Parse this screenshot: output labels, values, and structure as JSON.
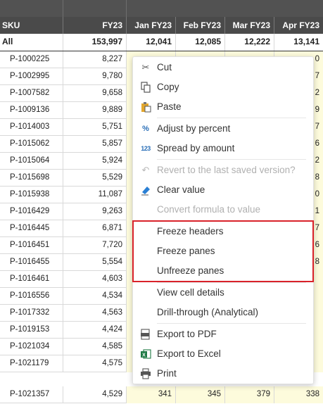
{
  "columns": {
    "sku": "SKU",
    "fy": "FY23",
    "months": [
      "Jan FY23",
      "Feb FY23",
      "Mar FY23",
      "Apr FY23"
    ]
  },
  "all_row": {
    "label": "All",
    "fy": "153,997",
    "months": [
      "12,041",
      "12,085",
      "12,222",
      "13,141"
    ]
  },
  "rows": [
    {
      "sku": "P-1000225",
      "fy": "8,227",
      "apr_tail": "0"
    },
    {
      "sku": "P-1002995",
      "fy": "9,780",
      "apr_tail": "7"
    },
    {
      "sku": "P-1007582",
      "fy": "9,658",
      "apr_tail": "2"
    },
    {
      "sku": "P-1009136",
      "fy": "9,889",
      "apr_tail": "9"
    },
    {
      "sku": "P-1014003",
      "fy": "5,751",
      "apr_tail": "7"
    },
    {
      "sku": "P-1015062",
      "fy": "5,857",
      "apr_tail": "6"
    },
    {
      "sku": "P-1015064",
      "fy": "5,924",
      "apr_tail": "2"
    },
    {
      "sku": "P-1015698",
      "fy": "5,529",
      "apr_tail": "8"
    },
    {
      "sku": "P-1015938",
      "fy": "11,087",
      "apr_tail": "0"
    },
    {
      "sku": "P-1016429",
      "fy": "9,263",
      "apr_tail": "1"
    },
    {
      "sku": "P-1016445",
      "fy": "6,871",
      "apr_tail": "7"
    },
    {
      "sku": "P-1016451",
      "fy": "7,720",
      "apr_tail": "6"
    },
    {
      "sku": "P-1016455",
      "fy": "5,554",
      "apr_tail": "8"
    },
    {
      "sku": "P-1016461",
      "fy": "4,603",
      "apr_tail": ""
    },
    {
      "sku": "P-1016556",
      "fy": "4,534",
      "apr_tail": ""
    },
    {
      "sku": "P-1017332",
      "fy": "4,563",
      "apr_tail": ""
    },
    {
      "sku": "P-1019153",
      "fy": "4,424",
      "apr_tail": ""
    },
    {
      "sku": "P-1021034",
      "fy": "4,585",
      "apr_tail": ""
    },
    {
      "sku": "P-1021179",
      "fy": "4,575",
      "apr_tail": ""
    }
  ],
  "last_row": {
    "sku": "P-1021357",
    "fy": "4,529",
    "months": [
      "341",
      "345",
      "379",
      "338"
    ]
  },
  "menu": {
    "items": [
      {
        "label": "Cut",
        "icon": "scissors-icon",
        "disabled": false
      },
      {
        "label": "Copy",
        "icon": "copy-icon",
        "disabled": false
      },
      {
        "label": "Paste",
        "icon": "paste-icon",
        "disabled": false
      },
      {
        "label": "Adjust by percent",
        "icon": "percent-icon",
        "disabled": false
      },
      {
        "label": "Spread by amount",
        "icon": "spread-123-icon",
        "disabled": false
      },
      {
        "label": "Revert to the last saved version?",
        "icon": "undo-icon",
        "disabled": true
      },
      {
        "label": "Clear value",
        "icon": "eraser-icon",
        "disabled": false
      },
      {
        "label": "Convert formula to value",
        "icon": "",
        "disabled": true
      },
      {
        "label": "Freeze headers",
        "icon": "",
        "disabled": false
      },
      {
        "label": "Freeze panes",
        "icon": "",
        "disabled": false
      },
      {
        "label": "Unfreeze panes",
        "icon": "",
        "disabled": false
      },
      {
        "label": "View cell details",
        "icon": "",
        "disabled": false
      },
      {
        "label": "Drill-through (Analytical)",
        "icon": "",
        "disabled": false
      },
      {
        "label": "Export to PDF",
        "icon": "pdf-icon",
        "disabled": false
      },
      {
        "label": "Export to Excel",
        "icon": "excel-icon",
        "disabled": false
      },
      {
        "label": "Print",
        "icon": "printer-icon",
        "disabled": false
      }
    ]
  },
  "colors": {
    "header_bg": "#4a4a4a",
    "edited_cell_bg": "#fdfbdc",
    "highlight_border": "#d9222a",
    "excel_green": "#1e7a45",
    "eraser_blue": "#2a7fd4",
    "paste_yellow": "#e3a72d"
  }
}
